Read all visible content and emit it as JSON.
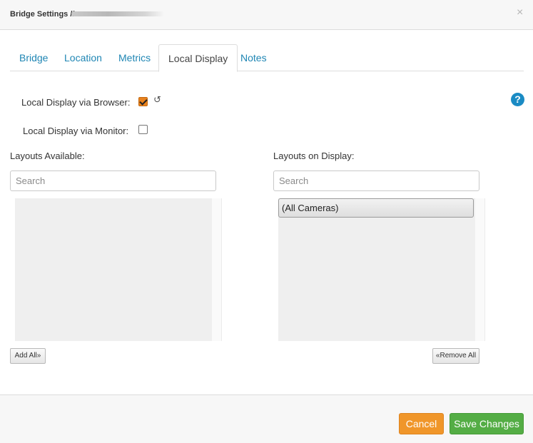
{
  "header": {
    "title": "Bridge Settings //",
    "close_symbol": "×"
  },
  "tabs": [
    {
      "label": "Bridge",
      "active": false
    },
    {
      "label": "Location",
      "active": false
    },
    {
      "label": "Metrics",
      "active": false
    },
    {
      "label": "Local Display",
      "active": true
    },
    {
      "label": "Notes",
      "active": false
    }
  ],
  "settings": {
    "browser_label": "Local Display via Browser:",
    "browser_checked": true,
    "monitor_label": "Local Display via Monitor:",
    "monitor_checked": false,
    "reset_symbol": "↺",
    "help_symbol": "?"
  },
  "available": {
    "label": "Layouts Available:",
    "search_placeholder": "Search",
    "items": [],
    "button": "Add All»"
  },
  "on_display": {
    "label": "Layouts on Display:",
    "search_placeholder": "Search",
    "items": [
      "(All Cameras)"
    ],
    "button": "«Remove All"
  },
  "footer": {
    "cancel": "Cancel",
    "save": "Save Changes"
  },
  "colors": {
    "accent_link": "#1f86b4",
    "cancel": "#f0962a",
    "save": "#54ad45",
    "help": "#1a8bc4",
    "checkbox": "#e8821e"
  }
}
